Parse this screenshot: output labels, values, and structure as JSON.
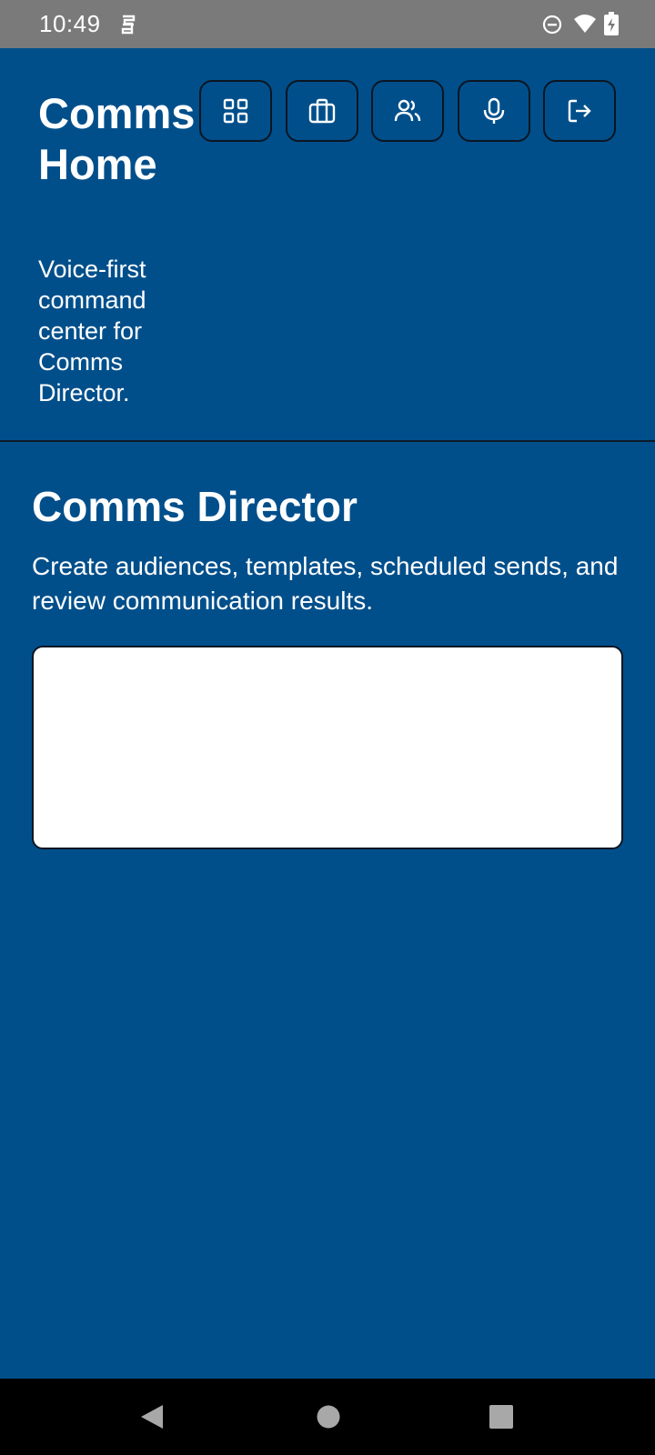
{
  "status_bar": {
    "time": "10:49",
    "icons": [
      "s-icon",
      "do-not-disturb-icon",
      "wifi-icon",
      "battery-charging-icon"
    ]
  },
  "header": {
    "title": "Comms Home",
    "subtitle": "Voice-first command center for Comms Director.",
    "buttons": [
      {
        "icon": "dashboard-grid-icon"
      },
      {
        "icon": "briefcase-icon"
      },
      {
        "icon": "users-icon"
      },
      {
        "icon": "microphone-icon"
      },
      {
        "icon": "logout-icon"
      }
    ]
  },
  "main": {
    "title": "Comms Director",
    "description": "Create audiences, templates, scheduled sends, and review communication results.",
    "command_input": {
      "value": "",
      "placeholder": ""
    }
  },
  "nav_bar": {
    "icons": [
      "back-icon",
      "home-icon",
      "recents-icon"
    ]
  },
  "colors": {
    "background": "#004f8b",
    "status_bar": "#7a7a7a",
    "nav_bar": "#000000",
    "text": "#ffffff",
    "border": "#0b1622"
  }
}
